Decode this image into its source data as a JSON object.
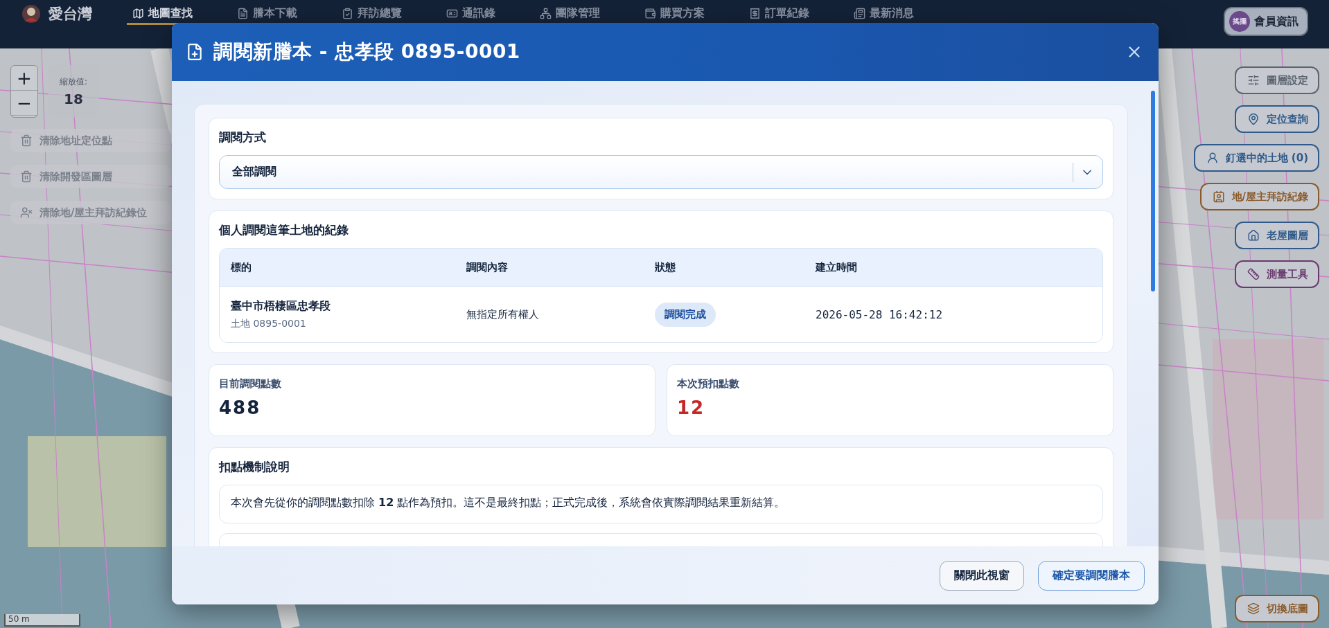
{
  "app": {
    "logo_text": "愛台灣"
  },
  "nav": {
    "items": [
      {
        "label": "地圖查找",
        "kind": "map",
        "selected": true
      },
      {
        "label": "謄本下載",
        "kind": "file",
        "selected": false
      },
      {
        "label": "拜訪總覽",
        "kind": "clipboard",
        "selected": false
      },
      {
        "label": "通訊錄",
        "kind": "card",
        "selected": false
      },
      {
        "label": "團隊管理",
        "kind": "team",
        "selected": false
      },
      {
        "label": "購買方案",
        "kind": "wallet",
        "selected": false
      },
      {
        "label": "訂單紀錄",
        "kind": "receipt",
        "selected": false
      },
      {
        "label": "最新消息",
        "kind": "news",
        "selected": false
      }
    ],
    "member": {
      "avatar_text": "搖擺",
      "label": "會員資訊"
    }
  },
  "map": {
    "zoom_in": "+",
    "zoom_out": "−",
    "zoom_label": "縮放值:",
    "zoom_value": "18",
    "scale": "50 m",
    "clear_buttons": [
      {
        "label": "清除地址定位點",
        "kind": "trash"
      },
      {
        "label": "清除開發區圖層",
        "kind": "trash"
      },
      {
        "label": "清除地/屋主拜訪紀錄位",
        "kind": "user-x"
      }
    ],
    "tools": [
      {
        "label": "圖層設定",
        "kind": "sliders",
        "color": "#5b6470"
      },
      {
        "label": "定位查詢",
        "kind": "pin",
        "color": "#2f5a8a"
      },
      {
        "label": "釘選中的土地 (0)",
        "kind": "person-pin",
        "color": "#2f5a8a"
      },
      {
        "label": "地/屋主拜訪紀錄",
        "kind": "contact",
        "color": "#8a5a2b"
      },
      {
        "label": "老屋圖層",
        "kind": "house",
        "color": "#2f5a8a"
      },
      {
        "label": "測量工具",
        "kind": "ruler",
        "color": "#6a3a6e"
      }
    ],
    "basemap_button": {
      "label": "切換底圖",
      "kind": "layers",
      "color": "#8a5a2b"
    }
  },
  "dialog": {
    "title": "調閱新謄本 - 忠孝段 0895-0001",
    "method": {
      "label": "調閱方式",
      "value": "全部調閱"
    },
    "records": {
      "title": "個人調閱這筆土地的紀錄",
      "columns": [
        "標的",
        "調閱內容",
        "狀態",
        "建立時間"
      ],
      "rows": [
        {
          "target": "臺中市梧棲區忠孝段",
          "target_sub": "土地 0895-0001",
          "content": "無指定所有權人",
          "status": "調閱完成",
          "created": "2026-05-28 16:42:12"
        }
      ]
    },
    "stats": [
      {
        "label": "目前調閱點數",
        "value": "488",
        "color": "#14243d"
      },
      {
        "label": "本次預扣點數",
        "value": "12",
        "color": "#c62828"
      }
    ],
    "deduction": {
      "title": "扣點機制說明",
      "notes": [
        "本次會先從你的調閱點數扣除 **12** 點作為預扣。這不是最終扣點；正式完成後，系統會依實際調閱結果重新結算。"
      ]
    },
    "buttons": [
      {
        "label": "關閉此視窗",
        "kind": "secondary"
      },
      {
        "label": "確定要調閱謄本",
        "kind": "primary"
      }
    ]
  }
}
